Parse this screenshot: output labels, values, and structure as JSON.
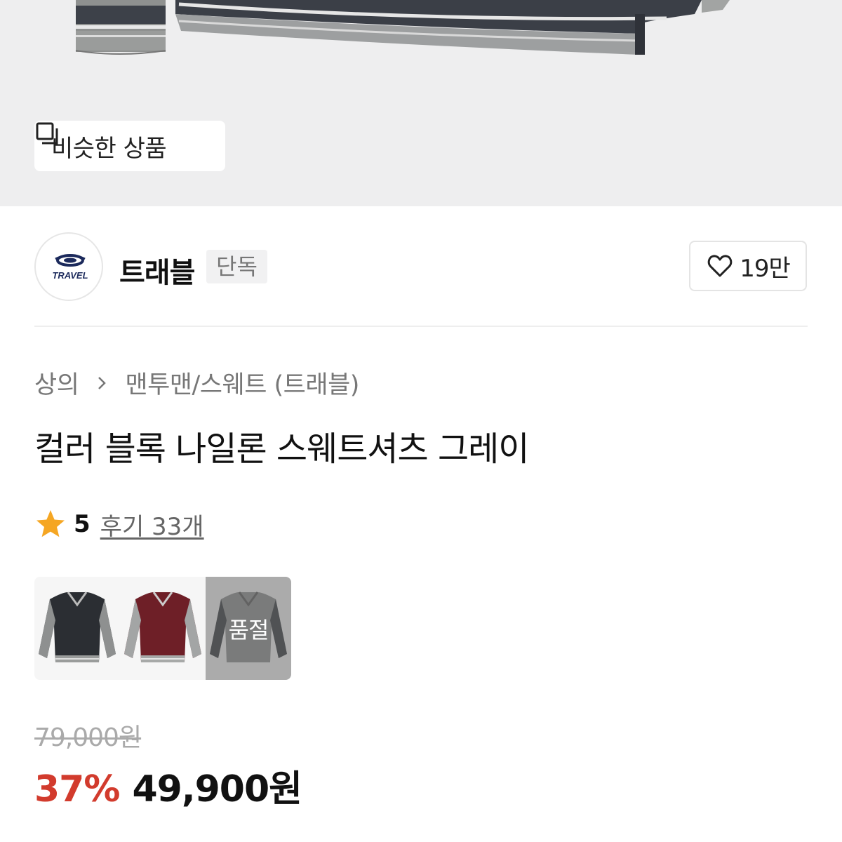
{
  "hero": {
    "similar_button_label": "비슷한 상품",
    "similar_icon": "similar-items-icon"
  },
  "brand": {
    "logo_text": "TRAVEL",
    "name": "트래블",
    "tag": "단독",
    "like_count": "19만",
    "like_icon": "heart-icon"
  },
  "breadcrumb": {
    "category": "상의",
    "subcategory": "맨투맨/스웨트 (트래블)",
    "separator_icon": "chevron-right-icon"
  },
  "product": {
    "title": "컬러 블록 나일론 스웨트셔츠 그레이",
    "rating": "5",
    "reviews": "후기 33개",
    "star_color": "#f5a623"
  },
  "variants": [
    {
      "color": "black-grey"
    },
    {
      "color": "burgundy-grey"
    },
    {
      "color": "grey",
      "overlay_label": "품절"
    }
  ],
  "price": {
    "original": "79,000원",
    "discount": "37%",
    "sale": "49,900원",
    "discount_color": "#d23b2d"
  }
}
